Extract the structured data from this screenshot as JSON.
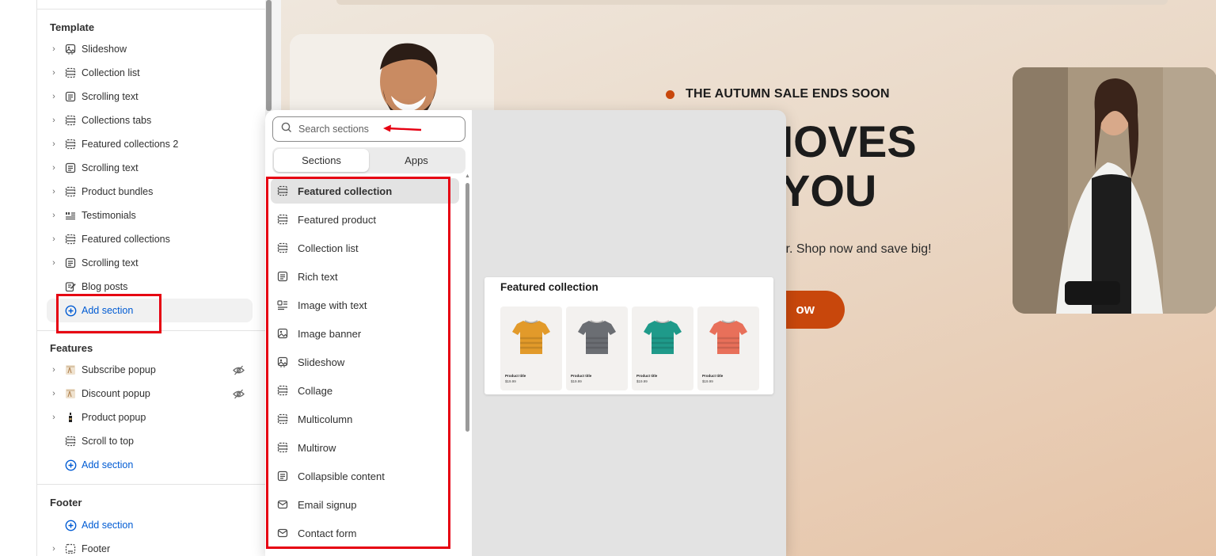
{
  "sidebar": {
    "template": {
      "title": "Template",
      "items": [
        {
          "label": "Slideshow",
          "icon": "slideshow-icon"
        },
        {
          "label": "Collection list",
          "icon": "section-icon"
        },
        {
          "label": "Scrolling text",
          "icon": "text-icon"
        },
        {
          "label": "Collections tabs",
          "icon": "section-icon"
        },
        {
          "label": "Featured collections 2",
          "icon": "section-icon"
        },
        {
          "label": "Scrolling text",
          "icon": "text-icon"
        },
        {
          "label": "Product bundles",
          "icon": "section-icon"
        },
        {
          "label": "Testimonials",
          "icon": "testimonials-icon"
        },
        {
          "label": "Featured collections",
          "icon": "section-icon"
        },
        {
          "label": "Scrolling text",
          "icon": "text-icon"
        },
        {
          "label": "Blog posts",
          "icon": "blog-icon"
        }
      ],
      "add_label": "Add section"
    },
    "features": {
      "title": "Features",
      "items": [
        {
          "label": "Subscribe popup",
          "icon": "popup-thumb-icon",
          "hidden": true
        },
        {
          "label": "Discount popup",
          "icon": "popup-thumb-icon",
          "hidden": true
        },
        {
          "label": "Product popup",
          "icon": "bottle-icon",
          "hidden": false
        },
        {
          "label": "Scroll to top",
          "icon": "section-icon",
          "hidden": false
        }
      ],
      "add_label": "Add section"
    },
    "footer": {
      "title": "Footer",
      "add_label": "Add section",
      "items": [
        {
          "label": "Footer",
          "icon": "footer-icon"
        }
      ]
    }
  },
  "preview": {
    "sale_text": "THE AUTUMN SALE ENDS SOON",
    "headline_line1": "HAT MOVES",
    "headline_line2": "YOU",
    "subtext": "ffer. Shop now and save big!",
    "button_label": "ow",
    "accent_color": "#c8470c"
  },
  "popover": {
    "search_placeholder": "Search sections",
    "tabs": [
      "Sections",
      "Apps"
    ],
    "selected_tab": "Sections",
    "sections": [
      {
        "label": "Featured collection",
        "icon": "section-icon"
      },
      {
        "label": "Featured product",
        "icon": "section-icon"
      },
      {
        "label": "Collection list",
        "icon": "section-icon"
      },
      {
        "label": "Rich text",
        "icon": "text-icon"
      },
      {
        "label": "Image with text",
        "icon": "image-text-icon"
      },
      {
        "label": "Image banner",
        "icon": "image-icon"
      },
      {
        "label": "Slideshow",
        "icon": "slideshow-icon"
      },
      {
        "label": "Collage",
        "icon": "section-icon"
      },
      {
        "label": "Multicolumn",
        "icon": "section-icon"
      },
      {
        "label": "Multirow",
        "icon": "section-icon"
      },
      {
        "label": "Collapsible content",
        "icon": "text-icon"
      },
      {
        "label": "Email signup",
        "icon": "email-icon"
      },
      {
        "label": "Contact form",
        "icon": "email-icon"
      }
    ],
    "highlighted": "Featured collection",
    "preview_card": {
      "title": "Featured collection",
      "products": [
        {
          "title": "Product title",
          "price": "$19.99",
          "color": "#e29a2a"
        },
        {
          "title": "Product title",
          "price": "$19.99",
          "color": "#6b6e73"
        },
        {
          "title": "Product title",
          "price": "$19.99",
          "color": "#1f9a8a"
        },
        {
          "title": "Product title",
          "price": "$19.99",
          "color": "#e8705a"
        }
      ]
    }
  }
}
